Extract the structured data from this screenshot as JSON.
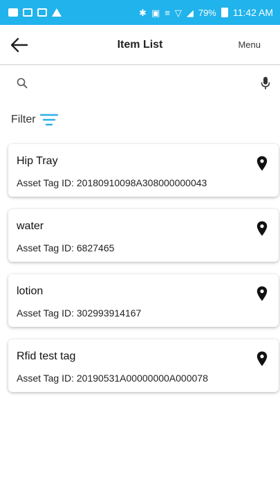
{
  "status_bar": {
    "time": "11:42 AM",
    "battery": "79%",
    "bg_color": "#20b3ec"
  },
  "app_bar": {
    "title": "Item List",
    "menu_label": "Menu",
    "back_icon": "arrow-left-icon"
  },
  "search": {
    "value": "",
    "placeholder": "",
    "search_icon": "search-icon",
    "mic_icon": "microphone-icon"
  },
  "filter": {
    "label": "Filter",
    "icon": "filter-icon",
    "icon_color": "#2bb0e8"
  },
  "items": [
    {
      "name": "Hip Tray",
      "tag": "Asset Tag ID: 20180910098A308000000043"
    },
    {
      "name": "water",
      "tag": "Asset Tag ID: 6827465"
    },
    {
      "name": "lotion",
      "tag": "Asset Tag ID: 302993914167"
    },
    {
      "name": "Rfid test tag",
      "tag": "Asset Tag ID: 20190531A00000000A000078"
    }
  ]
}
